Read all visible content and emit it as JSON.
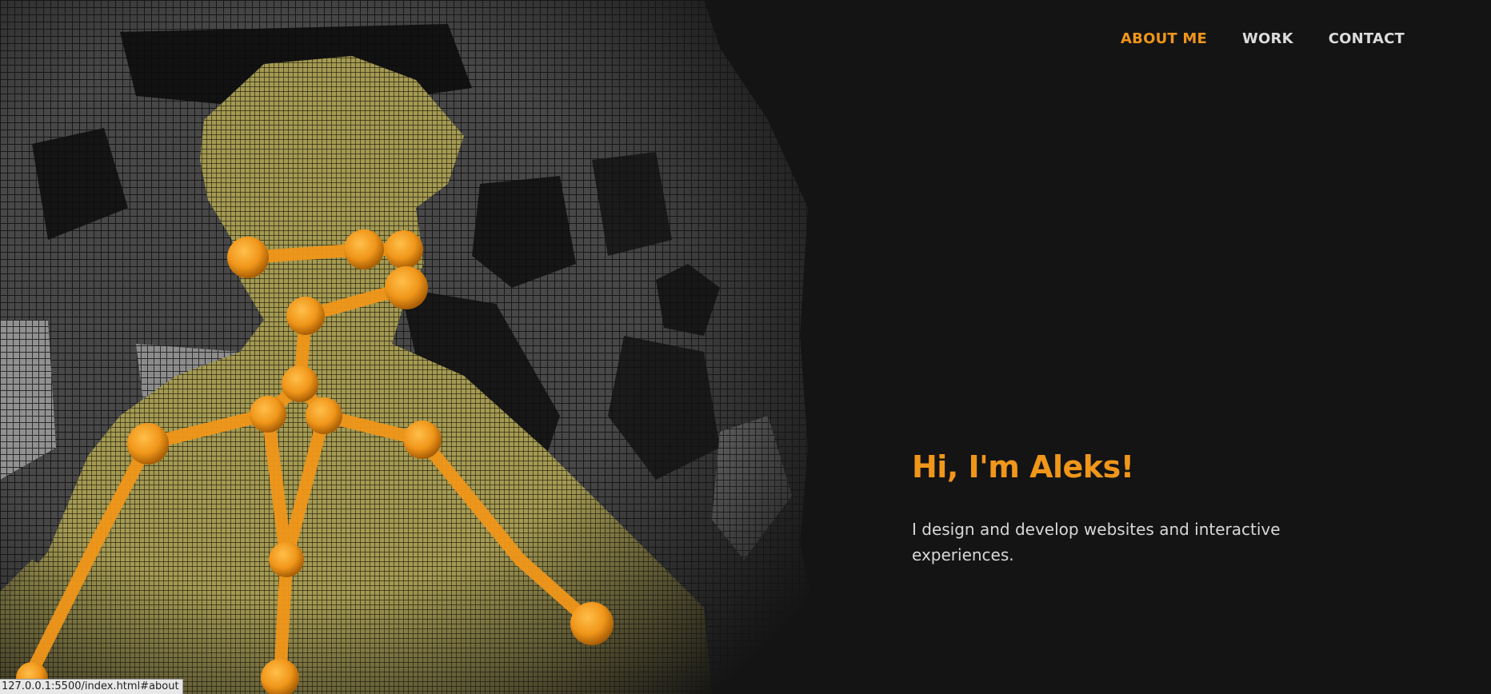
{
  "nav": {
    "items": [
      {
        "label": "ABOUT ME",
        "active": true
      },
      {
        "label": "WORK",
        "active": false
      },
      {
        "label": "CONTACT",
        "active": false
      }
    ]
  },
  "hero": {
    "heading": "Hi, I'm Aleks!",
    "tagline": "I design and develop websites and interactive experiences."
  },
  "status_bar": {
    "url": "127.0.0.1:5500/index.html#about"
  },
  "colors": {
    "accent": "#f0961a",
    "background": "#141414",
    "nav_text": "#dcdcdc",
    "body_text": "#d8d8d8"
  }
}
